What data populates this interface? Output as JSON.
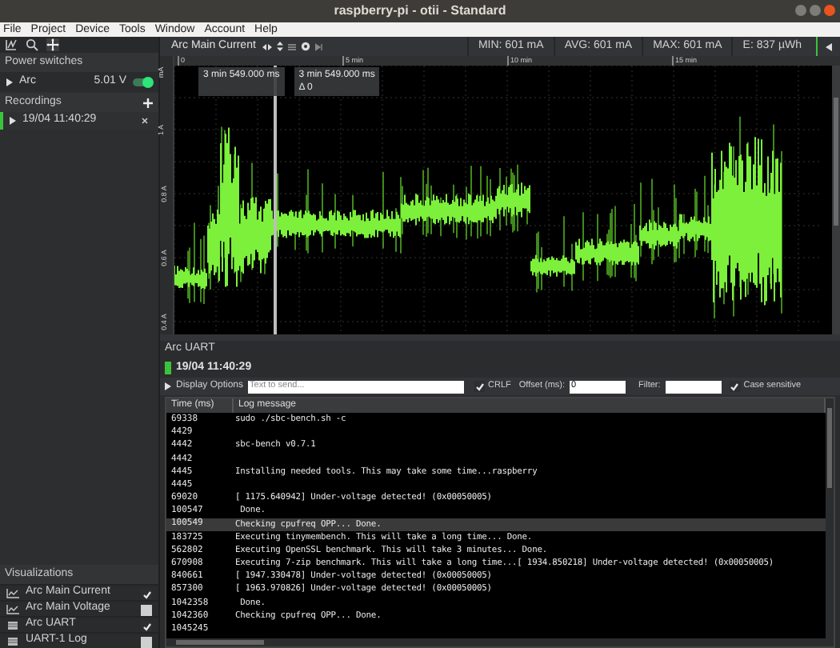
{
  "window": {
    "title": "raspberry-pi - otii - Standard"
  },
  "menu": [
    "File",
    "Project",
    "Device",
    "Tools",
    "Window",
    "Account",
    "Help"
  ],
  "sidebar": {
    "power_switches": {
      "title": "Power switches",
      "items": [
        {
          "name": "Arc",
          "reading": "5.01 V",
          "on": true,
          "expanded": false
        }
      ]
    },
    "recordings": {
      "title": "Recordings",
      "items": [
        {
          "label": "19/04 11:40:29",
          "selected": true
        }
      ]
    },
    "visualizations": {
      "title": "Visualizations",
      "items": [
        {
          "label": "Arc Main Current",
          "kind": "graph",
          "checked": true
        },
        {
          "label": "Arc Main Voltage",
          "kind": "graph",
          "checked": false
        },
        {
          "label": "Arc UART",
          "kind": "log",
          "checked": true
        },
        {
          "label": "UART-1 Log",
          "kind": "log",
          "checked": false
        }
      ]
    }
  },
  "chart_panel": {
    "title": "Arc Main Current",
    "stats": [
      "MIN: 601 mA",
      "AVG: 601 mA",
      "MAX: 601 mA",
      "E: 837 µWh"
    ],
    "time_ticks": [
      "0",
      "5 min",
      "10 min",
      "15 min"
    ],
    "y_labels": [
      "mA",
      "1 A",
      "0.8 A",
      "0.6 A",
      "0.4 A"
    ],
    "cursor_tooltips": [
      {
        "lines": [
          "3 min 549.000 ms"
        ]
      },
      {
        "lines": [
          "3 min 549.000 ms",
          "Δ 0"
        ]
      }
    ]
  },
  "uart_panel": {
    "title": "Arc UART",
    "recording": "19/04 11:40:29",
    "display_options": "Display Options",
    "send_placeholder": "Text to send...",
    "crlf": {
      "label": "CRLF",
      "checked": true
    },
    "offset": {
      "label": "Offset (ms):",
      "value": "0"
    },
    "filter": {
      "label": "Filter:"
    },
    "case_sensitive": {
      "label": "Case sensitive",
      "checked": true
    },
    "columns": [
      "Time (ms)",
      "Log message"
    ],
    "rows": [
      {
        "time": "69338",
        "message": "sudo ./sbc-bench.sh -c",
        "selected": false
      },
      {
        "time": "4429",
        "message": "",
        "selected": false
      },
      {
        "time": "4442",
        "message": "sbc-bench v0.7.1",
        "selected": false
      },
      {
        "time": "4442",
        "message": "",
        "selected": false
      },
      {
        "time": "4445",
        "message": "Installing needed tools. This may take some time...raspberry",
        "selected": false
      },
      {
        "time": "4445",
        "message": "",
        "selected": false
      },
      {
        "time": "69020",
        "message": "[ 1175.640942] Under-voltage detected! (0x00050005)",
        "selected": false
      },
      {
        "time": "100547",
        "message": " Done.",
        "selected": false
      },
      {
        "time": "100549",
        "message": "Checking cpufreq OPP... Done.",
        "selected": true
      },
      {
        "time": "183725",
        "message": "Executing tinymembench. This will take a long time... Done.",
        "selected": false
      },
      {
        "time": "562802",
        "message": "Executing OpenSSL benchmark. This will take 3 minutes... Done.",
        "selected": false
      },
      {
        "time": "670908",
        "message": "Executing 7-zip benchmark. This will take a long time...[ 1934.850218] Under-voltage detected! (0x00050005)",
        "selected": false
      },
      {
        "time": "840661",
        "message": "[ 1947.330478] Under-voltage detected! (0x00050005)",
        "selected": false
      },
      {
        "time": "857300",
        "message": "[ 1963.970826] Under-voltage detected! (0x00050005)",
        "selected": false
      },
      {
        "time": "1042358",
        "message": " Done.",
        "selected": false
      },
      {
        "time": "1042360",
        "message": "Checking cpufreq OPP... Done.",
        "selected": false
      },
      {
        "time": "1045245",
        "message": "",
        "selected": false
      }
    ]
  }
}
